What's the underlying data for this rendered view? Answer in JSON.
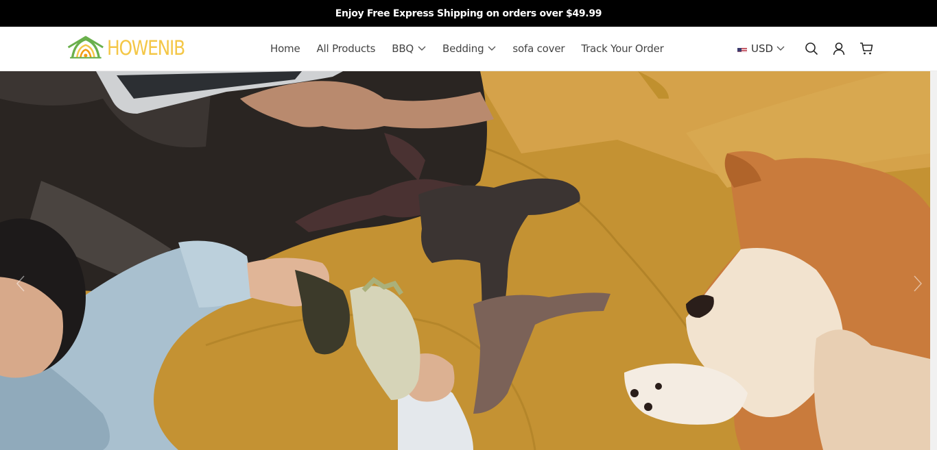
{
  "announcement": {
    "text": "Enjoy Free Express Shipping on orders over $49.99"
  },
  "header": {
    "logo": {
      "text": "HOWENIB",
      "colors": {
        "green": "#6ab04c",
        "yellow": "#f4c747",
        "orange": "#f39c12"
      }
    },
    "nav": [
      {
        "label": "Home",
        "has_dropdown": false
      },
      {
        "label": "All Products",
        "has_dropdown": false
      },
      {
        "label": "BBQ",
        "has_dropdown": true
      },
      {
        "label": "Bedding",
        "has_dropdown": true
      },
      {
        "label": "sofa cover",
        "has_dropdown": false
      },
      {
        "label": "Track Your Order",
        "has_dropdown": false
      }
    ],
    "currency": {
      "flag": "us-flag-icon",
      "label": "USD"
    },
    "icons": [
      "search-icon",
      "account-icon",
      "cart-icon"
    ]
  },
  "hero": {
    "image_description_icon": "hero-image",
    "colors": {
      "sofa": "#c08f2b",
      "blanket": "#2a2522",
      "dog": "#c97b3c"
    }
  }
}
